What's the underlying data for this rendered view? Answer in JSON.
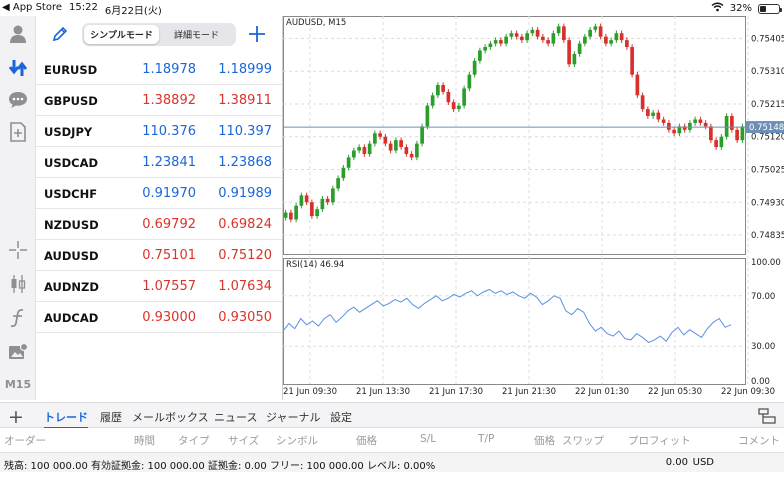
{
  "statusbar": {
    "app_back": "◀ App Store",
    "time": "15:22",
    "date": "6月22日(火)",
    "battery": "32%",
    "battery_level": 0.32
  },
  "toolbar": {
    "items": [
      "quotes-icon",
      "trade-icon",
      "chat-icon",
      "new-order-icon",
      "crosshair-icon",
      "candles-icon",
      "indicator-icon",
      "objects-icon"
    ],
    "timeframe": "M15"
  },
  "quotes": {
    "edit_icon": "pencil-icon",
    "mode_simple": "シンプルモード",
    "mode_detail": "詳細モード",
    "add_icon": "plus-icon",
    "rows": [
      {
        "symbol": "EURUSD",
        "bid": "1.18978",
        "ask": "1.18999",
        "color": "#1a66d9"
      },
      {
        "symbol": "GBPUSD",
        "bid": "1.38892",
        "ask": "1.38911",
        "color": "#d9342b"
      },
      {
        "symbol": "USDJPY",
        "bid": "110.376",
        "ask": "110.397",
        "color": "#1a66d9"
      },
      {
        "symbol": "USDCAD",
        "bid": "1.23841",
        "ask": "1.23868",
        "color": "#1a66d9"
      },
      {
        "symbol": "USDCHF",
        "bid": "0.91970",
        "ask": "0.91989",
        "color": "#1a66d9"
      },
      {
        "symbol": "NZDUSD",
        "bid": "0.69792",
        "ask": "0.69824",
        "color": "#d9342b"
      },
      {
        "symbol": "AUDUSD",
        "bid": "0.75101",
        "ask": "0.75120",
        "color": "#d9342b"
      },
      {
        "symbol": "AUDNZD",
        "bid": "1.07557",
        "ask": "1.07634",
        "color": "#d9342b"
      },
      {
        "symbol": "AUDCAD",
        "bid": "0.93000",
        "ask": "0.93050",
        "color": "#d9342b"
      }
    ]
  },
  "chart_data": {
    "type": "candlestick",
    "title": "AUDUSD, M15",
    "current_price": "0.75148",
    "y_ticks": [
      "0.75405",
      "0.75310",
      "0.75215",
      "0.75120",
      "0.75025",
      "0.74930",
      "0.74835"
    ],
    "ylim": [
      0.7478,
      0.7547
    ],
    "x_ticks": [
      "21 Jun 09:30",
      "21 Jun 13:30",
      "21 Jun 17:30",
      "21 Jun 21:30",
      "22 Jun 01:30",
      "22 Jun 05:30",
      "22 Jun 09:30"
    ],
    "candles_close": [
      0.749,
      0.7488,
      0.7492,
      0.7495,
      0.7493,
      0.7489,
      0.7491,
      0.7494,
      0.7493,
      0.7497,
      0.75,
      0.7503,
      0.7506,
      0.7508,
      0.7509,
      0.7507,
      0.751,
      0.7513,
      0.7512,
      0.751,
      0.7508,
      0.7511,
      0.7509,
      0.7507,
      0.7506,
      0.751,
      0.7515,
      0.7521,
      0.7524,
      0.7527,
      0.7525,
      0.7522,
      0.752,
      0.7521,
      0.7526,
      0.753,
      0.7534,
      0.7537,
      0.7538,
      0.7539,
      0.754,
      0.7539,
      0.7541,
      0.7542,
      0.7541,
      0.754,
      0.7542,
      0.7543,
      0.7541,
      0.754,
      0.7539,
      0.7542,
      0.7544,
      0.754,
      0.7533,
      0.7536,
      0.7539,
      0.7541,
      0.7543,
      0.7544,
      0.7541,
      0.7539,
      0.754,
      0.7542,
      0.754,
      0.7538,
      0.753,
      0.7524,
      0.752,
      0.7518,
      0.7519,
      0.7517,
      0.7516,
      0.7514,
      0.7513,
      0.7515,
      0.7514,
      0.7516,
      0.7517,
      0.7516,
      0.7515,
      0.7511,
      0.7509,
      0.7512,
      0.7518,
      0.7514,
      0.7511,
      0.7515
    ],
    "rsi_label": "RSI(14) 46.94",
    "rsi_ticks": [
      "100.00",
      "70.00",
      "30.00",
      "0.00"
    ],
    "rsi_values": [
      42,
      48,
      44,
      52,
      47,
      50,
      46,
      52,
      55,
      49,
      53,
      58,
      61,
      57,
      60,
      63,
      66,
      62,
      64,
      67,
      65,
      68,
      63,
      60,
      64,
      67,
      70,
      66,
      68,
      71,
      69,
      72,
      74,
      70,
      73,
      75,
      72,
      74,
      71,
      73,
      70,
      68,
      72,
      69,
      63,
      66,
      70,
      68,
      58,
      55,
      60,
      57,
      48,
      42,
      45,
      40,
      38,
      42,
      36,
      35,
      40,
      37,
      33,
      35,
      38,
      34,
      41,
      45,
      39,
      43,
      40,
      37,
      44,
      49,
      52,
      45,
      47
    ]
  },
  "tabs": {
    "items": [
      "トレード",
      "履歴",
      "メールボックス",
      "ニュース",
      "ジャーナル",
      "設定"
    ],
    "active": 0
  },
  "columns": [
    "オーダー",
    "時間",
    "タイプ",
    "サイズ",
    "シンボル",
    "価格",
    "S/L",
    "T/P",
    "価格",
    "スワップ",
    "プロフィット",
    "コメント"
  ],
  "footer": {
    "stats": "残高: 100 000.00 有効証拠金: 100 000.00 証拠金: 0.00 フリー: 100 000.00 レベル: 0.00%",
    "profit": "0.00",
    "currency": "USD"
  }
}
